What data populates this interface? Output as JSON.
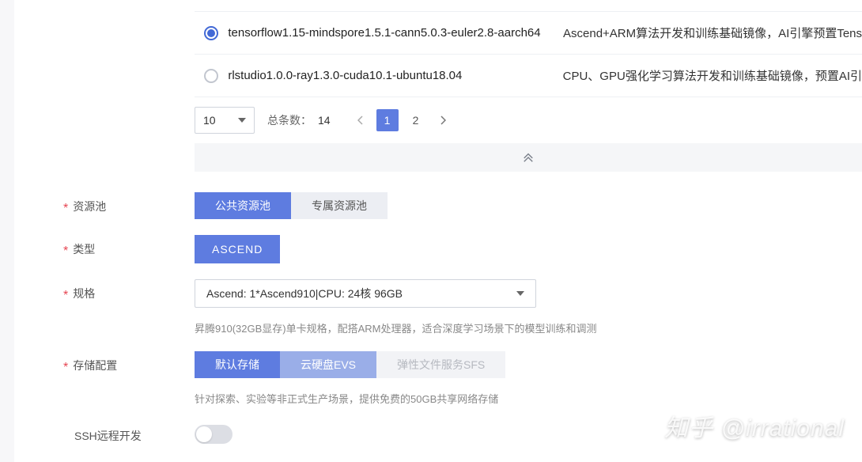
{
  "images": [
    {
      "name": "tensorflow1.15-mindspore1.5.1-cann5.0.3-euler2.8-aarch64",
      "desc": "Ascend+ARM算法开发和训练基础镜像，AI引擎预置Tens",
      "selected": true
    },
    {
      "name": "rlstudio1.0.0-ray1.3.0-cuda10.1-ubuntu18.04",
      "desc": "CPU、GPU强化学习算法开发和训练基础镜像，预置AI引",
      "selected": false
    }
  ],
  "pagination": {
    "page_size": "10",
    "total_label": "总条数：",
    "total": "14",
    "pages": [
      "1",
      "2"
    ],
    "current": "1"
  },
  "resource_pool": {
    "label": "资源池",
    "options": [
      "公共资源池",
      "专属资源池"
    ],
    "active": 0
  },
  "type": {
    "label": "类型",
    "value": "ASCEND"
  },
  "spec": {
    "label": "规格",
    "value": "Ascend: 1*Ascend910|CPU: 24核 96GB",
    "hint": "昇腾910(32GB显存)单卡规格，配搭ARM处理器，适合深度学习场景下的模型训练和调测"
  },
  "storage": {
    "label": "存储配置",
    "options": [
      "默认存储",
      "云硬盘EVS",
      "弹性文件服务SFS"
    ],
    "active": 0,
    "disabled_index": 2,
    "hint": "针对探索、实验等非正式生产场景，提供免费的50GB共享网络存储"
  },
  "ssh": {
    "label": "SSH远程开发"
  },
  "watermark": "知乎 @irrational"
}
